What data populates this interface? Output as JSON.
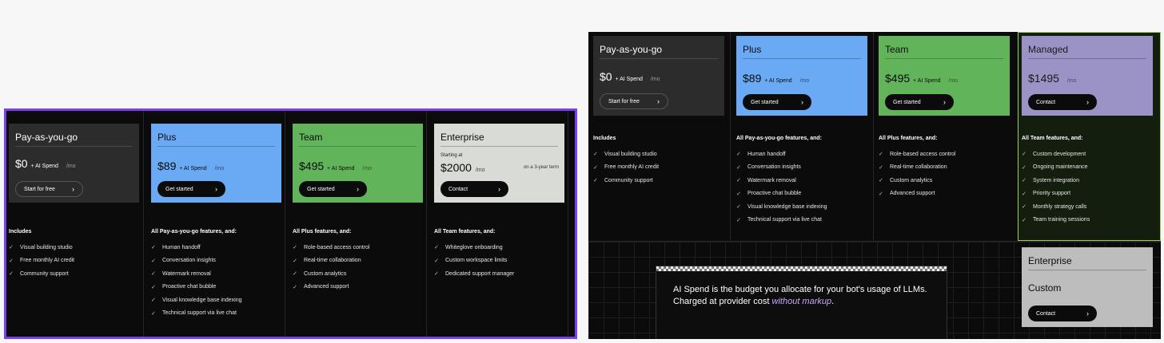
{
  "left": {
    "plans": [
      {
        "name": "Pay-as-you-go",
        "price": "$0",
        "spend": "+ AI Spend",
        "period": "/mo",
        "button": "Start for free",
        "style": "dark"
      },
      {
        "name": "Plus",
        "price": "$89",
        "spend": "+ AI Spend",
        "period": "/mo",
        "button": "Get started",
        "style": "blue"
      },
      {
        "name": "Team",
        "price": "$495",
        "spend": "+ AI Spend",
        "period": "/mo",
        "button": "Get started",
        "style": "green"
      },
      {
        "name": "Enterprise",
        "starting": "Starting at",
        "price": "$2000",
        "period": "/mo",
        "term": "on a 3-year term",
        "button": "Contact",
        "style": "grey"
      }
    ],
    "features": [
      {
        "heading": "Includes",
        "items": [
          "Visual building studio",
          "Free monthly AI credit",
          "Community support"
        ]
      },
      {
        "heading": "All Pay-as-you-go features, and:",
        "items": [
          "Human handoff",
          "Conversation insights",
          "Watermark removal",
          "Proactive chat bubble",
          "Visual knowledge base indexing",
          "Technical support via live chat"
        ]
      },
      {
        "heading": "All Plus features, and:",
        "items": [
          "Role-based access control",
          "Real-time collaboration",
          "Custom analytics",
          "Advanced support"
        ]
      },
      {
        "heading": "All Team features, and:",
        "items": [
          "Whiteglove onboarding",
          "Custom workspace limits",
          "Dedicated support manager"
        ]
      }
    ]
  },
  "right": {
    "plans": [
      {
        "name": "Pay-as-you-go",
        "price": "$0",
        "spend": "+ AI Spend",
        "period": "/mo",
        "button": "Start for free",
        "style": "dark"
      },
      {
        "name": "Plus",
        "price": "$89",
        "spend": "+ AI Spend",
        "period": "/mo",
        "button": "Get started",
        "style": "blue"
      },
      {
        "name": "Team",
        "price": "$495",
        "spend": "+ AI Spend",
        "period": "/mo",
        "button": "Get started",
        "style": "green"
      },
      {
        "name": "Managed",
        "price": "$1495",
        "spend": "",
        "period": "/mo",
        "button": "Contact",
        "style": "purple"
      }
    ],
    "features": [
      {
        "heading": "Includes",
        "items": [
          "Visual building studio",
          "Free monthly AI credit",
          "Community support"
        ]
      },
      {
        "heading": "All Pay-as-you-go features, and:",
        "items": [
          "Human handoff",
          "Conversation insights",
          "Watermark removal",
          "Proactive chat bubble",
          "Visual knowledge base indexing",
          "Technical support via live chat"
        ]
      },
      {
        "heading": "All Plus features, and:",
        "items": [
          "Role-based access control",
          "Real-time collaboration",
          "Custom analytics",
          "Advanced support"
        ]
      },
      {
        "heading": "All Team features, and:",
        "items": [
          "Custom development",
          "Ongoing maintenance",
          "System integration",
          "Priority support",
          "Monthly strategy calls",
          "Team training sessions"
        ]
      }
    ],
    "enterprise": {
      "name": "Enterprise",
      "price": "Custom",
      "button": "Contact"
    },
    "ai_spend": {
      "line1": "AI Spend is the budget you allocate for your bot's usage of LLMs.",
      "line2_prefix": "Charged at provider cost ",
      "line2_emph": "without markup",
      "line2_suffix": "."
    }
  },
  "icons": {
    "check": "check-icon",
    "chevron": "chevron-right-icon"
  },
  "colors": {
    "highlight_border": "#7b3ff2",
    "managed_border": "#9acd5f",
    "plus": "#6aaaf5",
    "team": "#62b45a",
    "enterprise": "#d9dbd6",
    "managed": "#9b93c6"
  }
}
